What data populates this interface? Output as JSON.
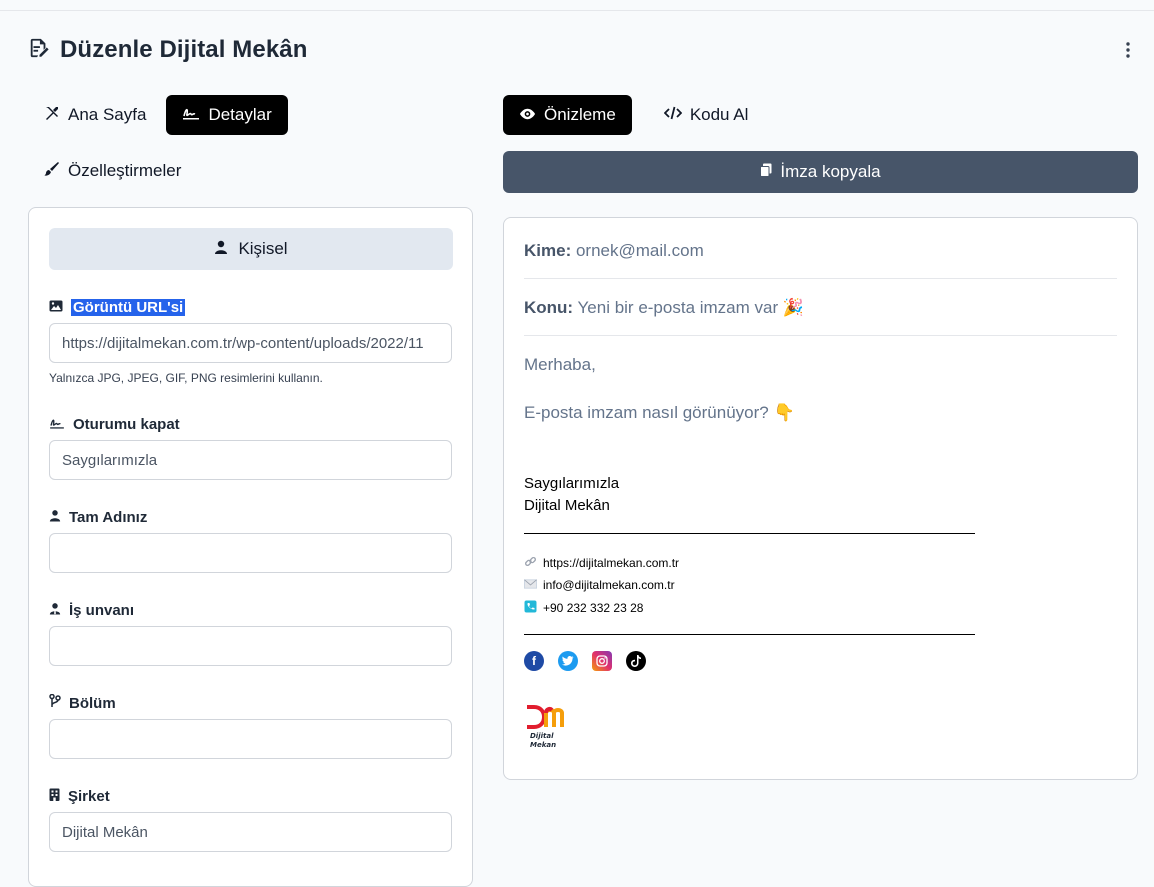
{
  "header": {
    "title": "Düzenle Dijital Mekân",
    "title_icon": "edit-document-icon",
    "menu_icon": "more-vertical-icon"
  },
  "left_tabs": [
    {
      "label": "Ana Sayfa",
      "icon": "tools-icon",
      "active": false
    },
    {
      "label": "Detaylar",
      "icon": "signature-icon",
      "active": true
    },
    {
      "label": "Özelleştirmeler",
      "icon": "brush-icon",
      "active": false
    }
  ],
  "section": {
    "label": "Kişisel",
    "icon": "user-icon"
  },
  "fields": {
    "image_url": {
      "label": "Görüntü URL'si",
      "value": "https://dijitalmekan.com.tr/wp-content/uploads/2022/11",
      "hint": "Yalnızca JPG, JPEG, GIF, PNG resimlerini kullanın."
    },
    "signoff": {
      "label": "Oturumu kapat",
      "value": "Saygılarımızla"
    },
    "full_name": {
      "label": "Tam Adınız",
      "value": ""
    },
    "job_title": {
      "label": "İş unvanı",
      "value": ""
    },
    "department": {
      "label": "Bölüm",
      "value": ""
    },
    "company": {
      "label": "Şirket",
      "value": "Dijital Mekân"
    }
  },
  "right_tabs": [
    {
      "label": "Önizleme",
      "icon": "eye-icon",
      "active": true
    },
    {
      "label": "Kodu Al",
      "icon": "code-icon",
      "active": false
    }
  ],
  "copy_button": {
    "label": "İmza kopyala",
    "icon": "copy-icon"
  },
  "preview": {
    "to_label": "Kime:",
    "to_value": "ornek@mail.com",
    "subject_label": "Konu:",
    "subject_value": "Yeni bir e-posta imzam var 🎉",
    "greeting": "Merhaba,",
    "question": "E-posta imzam nasıl görünüyor? 👇",
    "signature": {
      "signoff": "Saygılarımızla",
      "company": "Dijital Mekân",
      "website": "https://dijitalmekan.com.tr",
      "email": "info@dijitalmekan.com.tr",
      "phone": "+90 232 332 23 28"
    },
    "social": [
      "facebook-icon",
      "twitter-icon",
      "instagram-icon",
      "tiktok-icon"
    ],
    "logo_text_line1": "Dijital",
    "logo_text_line2": "Mekan"
  },
  "colors": {
    "primary_dark": "#000000",
    "copy_button": "#475569",
    "section_bg": "#e2e8f0",
    "highlight": "#2563eb",
    "facebook": "#1877f2",
    "twitter": "#1d9bf0",
    "logo_red": "#e11d2e",
    "logo_orange": "#f59e0b"
  }
}
